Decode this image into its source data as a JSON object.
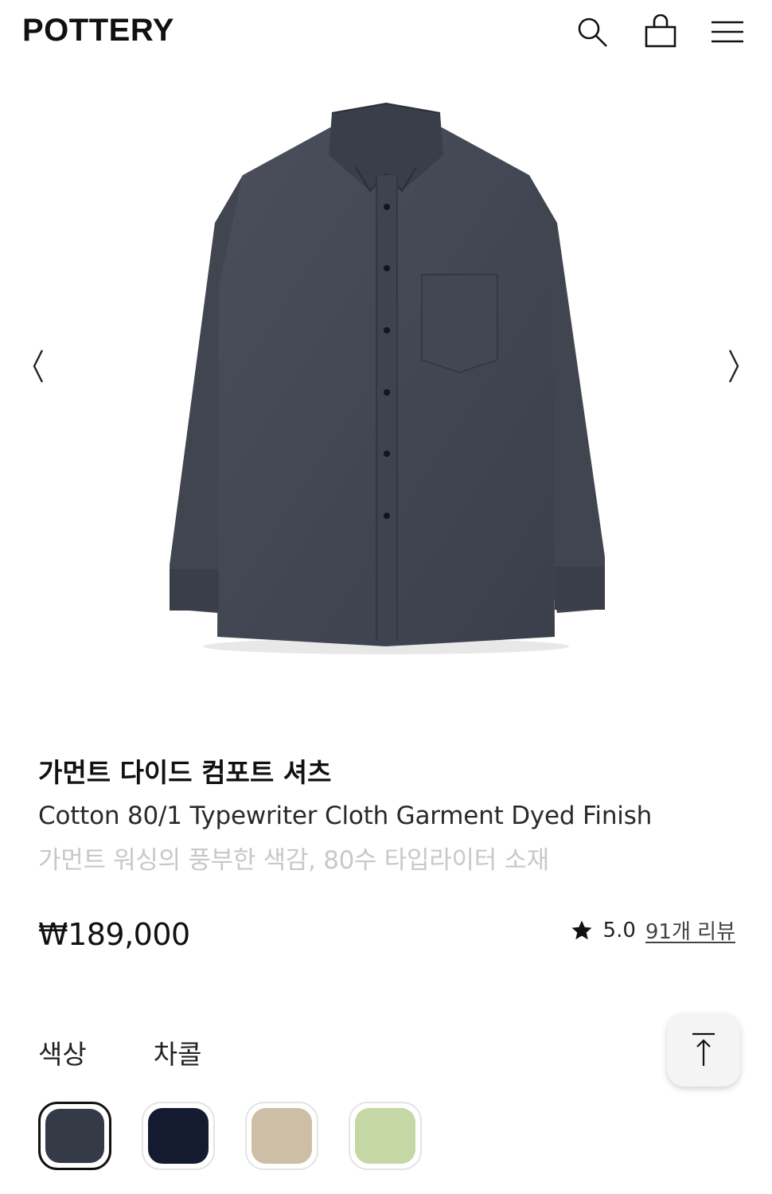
{
  "brand": {
    "logo_text": "POTTERY"
  },
  "header": {
    "icons": [
      "search-icon",
      "shopping-bag-icon",
      "hamburger-menu-icon"
    ]
  },
  "gallery": {
    "image_alt": "Charcoal long-sleeve button-down shirt",
    "prev_icon": "chevron-left-icon",
    "next_icon": "chevron-right-icon"
  },
  "product": {
    "title": "가먼트 다이드 컴포트 셔츠",
    "subtitle": "Cotton 80/1 Typewriter Cloth Garment Dyed Finish",
    "description": "가먼트 워싱의 풍부한 색감, 80수 타입라이터 소재",
    "price": "₩189,000",
    "rating": "5.0",
    "reviews_label": "91개 리뷰"
  },
  "colors": {
    "label": "색상",
    "selected_name": "차콜",
    "swatches": [
      {
        "name": "charcoal",
        "hex": "#353a47",
        "selected": true
      },
      {
        "name": "navy",
        "hex": "#141a30",
        "selected": false
      },
      {
        "name": "beige",
        "hex": "#cdbfa6",
        "selected": false
      },
      {
        "name": "light-green",
        "hex": "#c5d7a4",
        "selected": false
      }
    ]
  },
  "scroll_top": {
    "icon": "arrow-up-to-top-icon"
  }
}
